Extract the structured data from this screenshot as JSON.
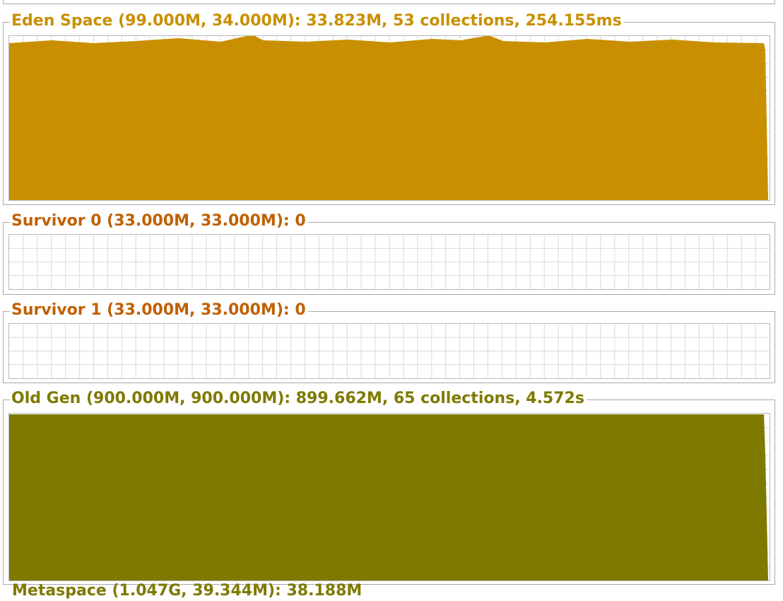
{
  "colors": {
    "eden": "#c89000",
    "survivor": "#c06000",
    "old": "#7e7a00",
    "grid": "#d9d9d9",
    "border": "#a8a8a8"
  },
  "panels": {
    "eden": {
      "title": "Eden Space (99.000M, 34.000M): 33.823M, 53 collections, 254.155ms",
      "used_fraction": 0.995
    },
    "survivor0": {
      "title": "Survivor 0 (33.000M, 33.000M): 0",
      "used_fraction": 0
    },
    "survivor1": {
      "title": "Survivor 1 (33.000M, 33.000M): 0",
      "used_fraction": 0
    },
    "old_gen": {
      "title": "Old Gen (900.000M, 900.000M): 899.662M, 65 collections, 4.572s",
      "used_fraction": 1.0
    },
    "metaspace": {
      "title": "Metaspace (1.047G, 39.344M): 38.188M"
    }
  }
}
